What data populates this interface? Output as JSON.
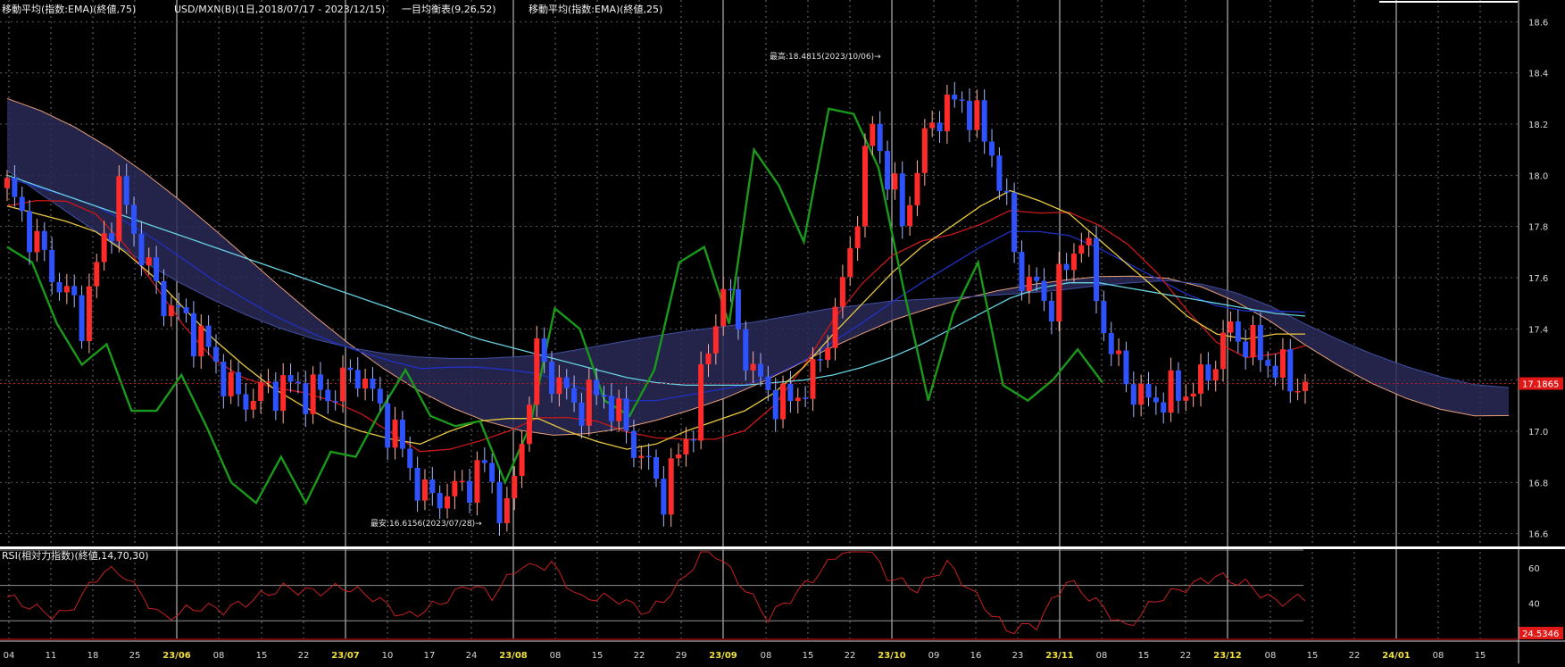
{
  "header": {
    "items": [
      "移動平均(指数:EMA)(終値,75)",
      "USD/MXN(B)(1日,2018/07/17 - 2023/12/15)",
      "一目均衡表(9,26,52)",
      "移動平均(指数:EMA)(終値,25)"
    ]
  },
  "annotations": {
    "high": "最高:18.4815(2023/10/06)→",
    "low": "最安:16.6156(2023/07/28)→"
  },
  "price_axis": {
    "ticks": [
      "18.6",
      "18.4",
      "18.2",
      "18.0",
      "17.8",
      "17.6",
      "17.4",
      "17.2",
      "17.0",
      "16.8",
      "16.6"
    ],
    "current_label": "17.1865",
    "current_value": 17.1865
  },
  "rsi_panel": {
    "title": "RSI(相対力指数)(終値,14,70,30)",
    "ticks": [
      "60",
      "40"
    ],
    "current_label": "24.5346"
  },
  "date_axis": {
    "labels": [
      "04",
      "11",
      "18",
      "25",
      "23/06",
      "08",
      "15",
      "22",
      "23/07",
      "10",
      "17",
      "24",
      "23/08",
      "08",
      "15",
      "22",
      "29",
      "23/09",
      "08",
      "15",
      "22",
      "23/10",
      "09",
      "16",
      "23",
      "23/11",
      "08",
      "15",
      "22",
      "23/12",
      "08",
      "15",
      "22",
      "24/01",
      "08",
      "15"
    ],
    "highlight": [
      "23/06",
      "23/07",
      "23/08",
      "23/09",
      "23/10",
      "23/11",
      "23/12",
      "24/01"
    ]
  },
  "colors": {
    "up": "#ff2a2a",
    "down": "#2f52ff",
    "ema75": "#66d0e0",
    "ema25": "#e8c840",
    "tenkan": "#c81818",
    "kijun": "#2030c0",
    "chikou": "#1a9a1a",
    "rsi": "#c82020",
    "cloud_bull": "#2a2a58",
    "cloud_bear": "#3c1a08",
    "span_edge": "#e8a078",
    "grid": "#9a9a9a"
  },
  "chart_data": {
    "type": "candlestick",
    "title": "USD/MXN(B)(1日,2018/07/17 - 2023/12/15)",
    "ylim": [
      16.55,
      18.65
    ],
    "series": [
      {
        "name": "移動平均(指数:EMA)(終値,75)",
        "values": [
          18.0,
          17.96,
          17.92,
          17.88,
          17.84,
          17.8,
          17.76,
          17.72,
          17.68,
          17.64,
          17.6,
          17.56,
          17.52,
          17.48,
          17.44,
          17.4,
          17.36,
          17.33,
          17.3,
          17.27,
          17.24,
          17.21,
          17.19,
          17.18,
          17.18,
          17.18,
          17.19,
          17.2,
          17.22,
          17.25,
          17.29,
          17.34,
          17.4,
          17.46,
          17.52,
          17.56,
          17.58,
          17.58,
          17.56,
          17.54,
          17.52,
          17.5,
          17.48,
          17.46,
          17.45
        ]
      },
      {
        "name": "移動平均(指数:EMA)(終値,25)",
        "values": [
          17.88,
          17.85,
          17.82,
          17.78,
          17.7,
          17.6,
          17.48,
          17.36,
          17.26,
          17.17,
          17.1,
          17.04,
          17.0,
          16.97,
          16.95,
          17.0,
          17.04,
          17.05,
          17.05,
          17.0,
          16.96,
          16.93,
          16.95,
          17.0,
          17.04,
          17.08,
          17.15,
          17.25,
          17.38,
          17.5,
          17.62,
          17.72,
          17.8,
          17.88,
          17.94,
          17.9,
          17.85,
          17.75,
          17.65,
          17.55,
          17.45,
          17.38,
          17.36,
          17.38,
          17.38
        ]
      },
      {
        "name": "一目均衡表(9,26,52)",
        "values": [
          17.72,
          17.66,
          17.42,
          17.26,
          17.34,
          17.08,
          17.08,
          17.22,
          17.02,
          16.8,
          16.72,
          16.9,
          16.72,
          16.92,
          16.9,
          17.08,
          17.24,
          17.06,
          17.02,
          17.04,
          16.8,
          17.02,
          17.48,
          17.4,
          17.12,
          17.06,
          17.24,
          17.66,
          17.72,
          17.42,
          18.1,
          17.96,
          17.74,
          18.26,
          18.24,
          18.03,
          17.56,
          17.12,
          17.46,
          17.66,
          17.18,
          17.12,
          17.2,
          17.32,
          17.19
        ]
      }
    ],
    "rsi_ylim": [
      20,
      70
    ]
  }
}
